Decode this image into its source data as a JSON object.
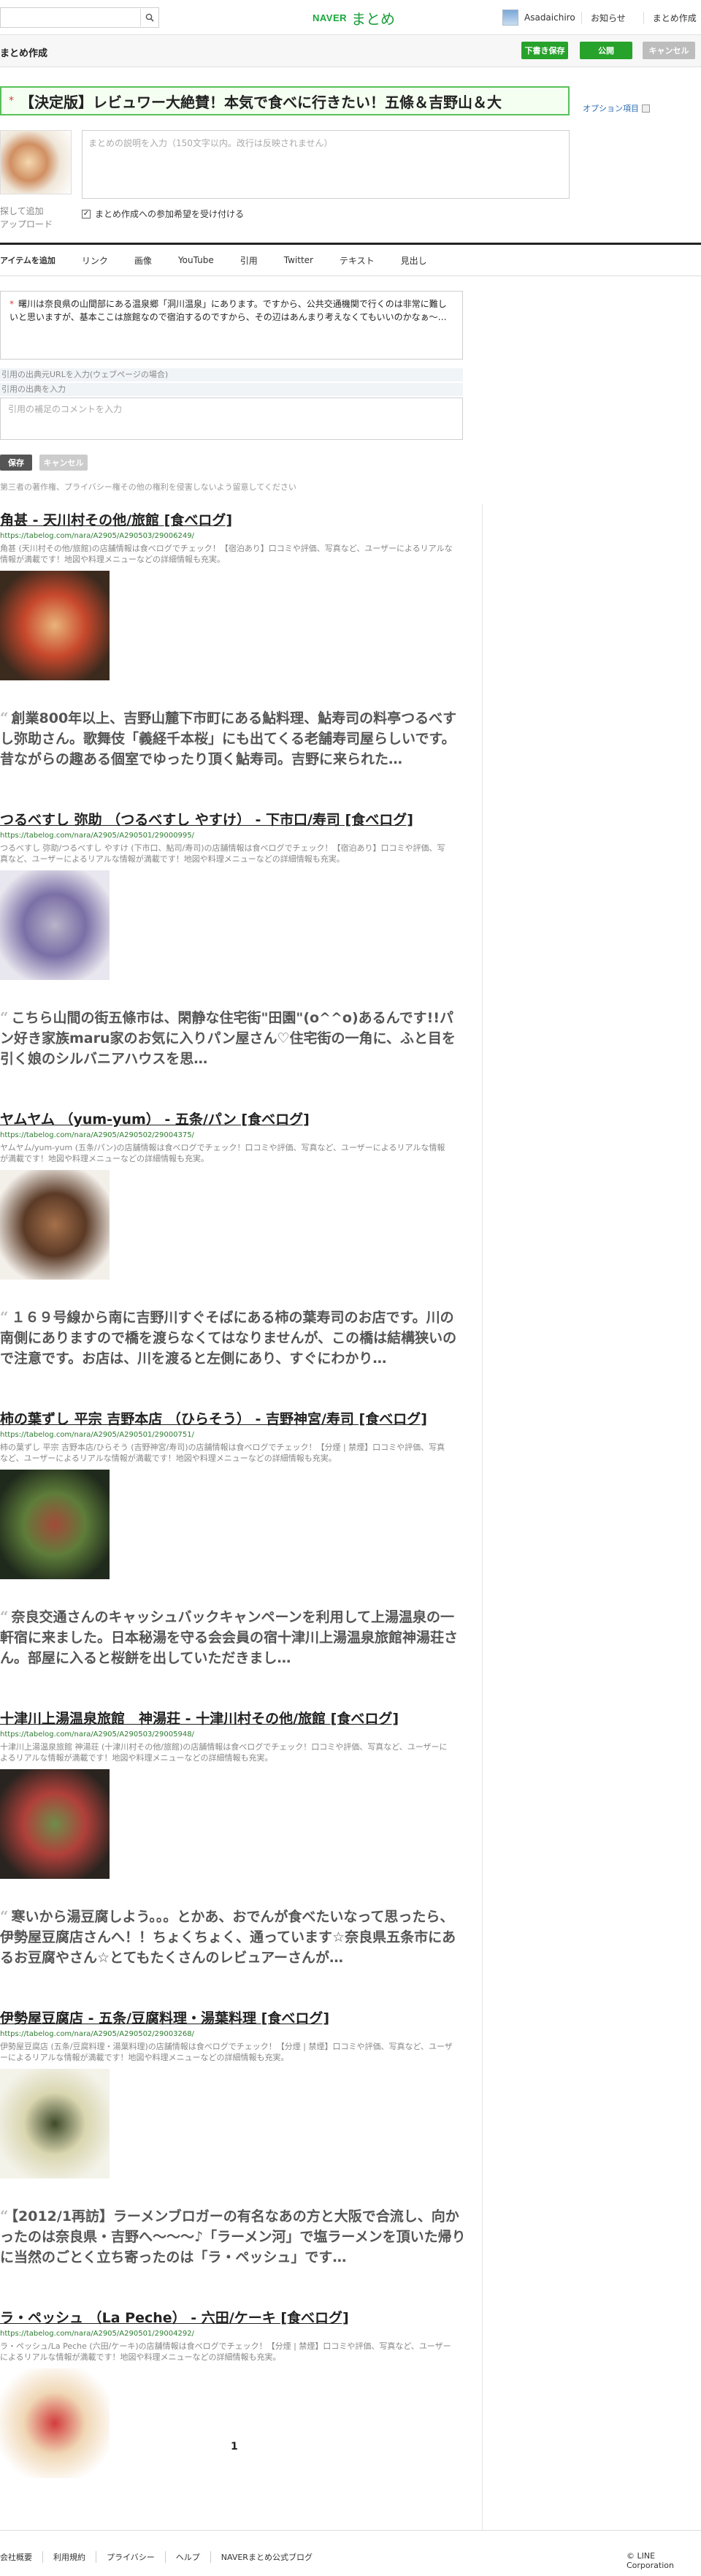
{
  "header": {
    "logo_naver": "NAVER",
    "logo_matome": "まとめ",
    "user_name": "Asadaichiro",
    "links": [
      "お知らせ",
      "まとめ作成"
    ]
  },
  "editor": {
    "title": "まとめ作成",
    "draft_label": "下書き保存",
    "publish_label": "公開",
    "cancel_label": "キャンセル",
    "matome_title": "【決定版】レビュワー大絶賛！本気で食べに行きたい！五條＆吉野山＆大",
    "option_label": "オプション項目",
    "desc_placeholder": "まとめの説明を入力（150文字以内。改行は反映されません）",
    "thumb_link_1": "探して追加",
    "thumb_link_2": "アップロード",
    "participate_label": "まとめ作成への参加希望を受け付ける"
  },
  "tabs": [
    "アイテムを追加",
    "リンク",
    "画像",
    "YouTube",
    "引用",
    "Twitter",
    "テキスト",
    "見出し"
  ],
  "item_editor": {
    "quote_text": "曙川は奈良県の山間部にある温泉郷「洞川温泉」にあります。ですから、公共交通機関で行くのは非常に難しいと思いますが、基本ここは旅館なので宿泊するのですから、その辺はあんまり考えなくてもいいのかなぁ〜…",
    "url_placeholder": "引用の出典元URLを入力(ウェブページの場合)",
    "source_placeholder": "引用の出典を入力",
    "comment_placeholder": "引用の補足のコメントを入力",
    "save_label": "保存",
    "cancel_label": "キャンセル",
    "notice": "第三者の著作権、プライバシー権その他の権利を侵害しないよう留意してください"
  },
  "items": [
    {
      "type": "link",
      "title": "角甚 - 天川村その他/旅館 [食べログ]",
      "url": "https://tabelog.com/nara/A2905/A290503/29006249/",
      "desc": "角甚 (天川村その他/旅館)の店舗情報は食べログでチェック！【宿泊あり】口コミや評価、写真など、ユーザーによるリアルな情報が満載です！地図や料理メニューなどの詳細情報も充実。",
      "colors": [
        "#3b2a1e",
        "#c7482c",
        "#e9b47a"
      ]
    },
    {
      "type": "quote",
      "text": "創業800年以上、吉野山麓下市町にある鮎料理、鮎寿司の料亭つるべすし弥助さん。歌舞伎「義経千本桜」にも出てくる老舗寿司屋らしいです。昔ながらの趣ある個室でゆったり頂く鮎寿司。吉野に来られた…"
    },
    {
      "type": "link",
      "title": "つるべすし 弥助 （つるべすし やすけ） - 下市口/寿司 [食べログ]",
      "url": "https://tabelog.com/nara/A2905/A290501/29000995/",
      "desc": "つるべすし 弥助/つるべすし やすけ (下市口、鮎司/寿司)の店舗情報は食べログでチェック！【宿泊あり】口コミや評価、写真など、ユーザーによるリアルな情報が満載です！地図や料理メニューなどの詳細情報も充実。",
      "colors": [
        "#e8e6ee",
        "#7b6fa6",
        "#b9b3c9"
      ]
    },
    {
      "type": "quote",
      "text": "こちら山間の街五條市は、閑静な住宅街\"田園\"(o^^o)あるんです!!パン好き家族maru家のお気に入りパン屋さん♡住宅街の一角に、ふと目を引く娘のシルバニアハウスを思…"
    },
    {
      "type": "link",
      "title": "ヤムヤム （yum-yum） - 五条/パン [食べログ]",
      "url": "https://tabelog.com/nara/A2905/A290502/29004375/",
      "desc": "ヤムヤム/yum-yum (五条/パン)の店舗情報は食べログでチェック！口コミや評価、写真など、ユーザーによるリアルな情報が満載です！地図や料理メニューなどの詳細情報も充実。",
      "colors": [
        "#f3efe9",
        "#5b3a26",
        "#a5704a"
      ]
    },
    {
      "type": "quote",
      "text": "１６９号線から南に吉野川すぐそばにある柿の葉寿司のお店です。川の南側にありますので橋を渡らなくてはなりませんが、この橋は結構狭いので注意です。お店は、川を渡ると左側にあり、すぐにわかり…"
    },
    {
      "type": "link",
      "title": "柿の葉ずし 平宗 吉野本店 （ひらそう） - 吉野神宮/寿司 [食べログ]",
      "url": "https://tabelog.com/nara/A2905/A290501/29000751/",
      "desc": "柿の葉ずし 平宗 吉野本店/ひらそう (吉野神宮/寿司)の店舗情報は食べログでチェック！【分煙 | 禁煙】口コミや評価、写真など、ユーザーによるリアルな情報が満載です！地図や料理メニューなどの詳細情報も充実。",
      "colors": [
        "#1f2a1c",
        "#5e7d3a",
        "#a24b3a"
      ]
    },
    {
      "type": "quote",
      "text": "奈良交通さんのキャッシュバックキャンペーンを利用して上湯温泉の一軒宿に来ました。日本秘湯を守る会会員の宿十津川上湯温泉旅館神湯荘さん。部屋に入ると桜餅を出していただきまし…"
    },
    {
      "type": "link",
      "title": "十津川上湯温泉旅館　神湯荘 - 十津川村その他/旅館 [食べログ]",
      "url": "https://tabelog.com/nara/A2905/A290503/29005948/",
      "desc": "十津川上湯温泉旅館 神湯荘 (十津川村その他/旅館)の店舗情報は食べログでチェック！口コミや評価、写真など、ユーザーによるリアルな情報が満載です！地図や料理メニューなどの詳細情報も充実。",
      "colors": [
        "#2a2420",
        "#b0403a",
        "#6f8c4a"
      ]
    },
    {
      "type": "quote",
      "text": "寒いから湯豆腐しよう。。。とかあ、おでんが食べたいなって思ったら、伊勢屋豆腐店さんへ！！ちょくちょく、通っています☆奈良県五条市にあるお豆腐やさん☆とてもたくさんのレビュアーさんが…"
    },
    {
      "type": "link",
      "title": "伊勢屋豆腐店 - 五条/豆腐料理・湯葉料理 [食べログ]",
      "url": "https://tabelog.com/nara/A2905/A290502/29003268/",
      "desc": "伊勢屋豆腐店 (五条/豆腐料理・湯葉料理)の店舗情報は食べログでチェック！【分煙 | 禁煙】口コミや評価、写真など、ユーザーによるリアルな情報が満載です！地図や料理メニューなどの詳細情報も充実。",
      "colors": [
        "#f4f3ea",
        "#d9d6b0",
        "#3e4a2a"
      ]
    },
    {
      "type": "quote",
      "text": "【2012/1再訪】ラーメンブロガーの有名なあの方と大阪で合流し、向かったのは奈良県・吉野へ〜〜〜♪「ラーメン河」で塩ラーメンを頂いた帰りに当然のごとく立ち寄ったのは「ラ・ペッシュ」です…"
    },
    {
      "type": "link",
      "title": "ラ・ペッシュ （La Peche） - 六田/ケーキ [食べログ]",
      "url": "https://tabelog.com/nara/A2905/A290501/29004292/",
      "desc": "ラ・ペッシュ/La Peche (六田/ケーキ)の店舗情報は食べログでチェック！【分煙 | 禁煙】口コミや評価、写真など、ユーザーによるリアルな情報が満載です！地図や料理メニューなどの詳細情報も充実。",
      "colors": [
        "#ffffff",
        "#f0d7b5",
        "#d23c3c"
      ]
    }
  ],
  "pager": "1",
  "footer": {
    "links": [
      "会社概要",
      "利用規約",
      "プライバシー",
      "ヘルプ",
      "NAVERまとめ公式ブログ"
    ],
    "copyright": "© LINE Corporation"
  }
}
